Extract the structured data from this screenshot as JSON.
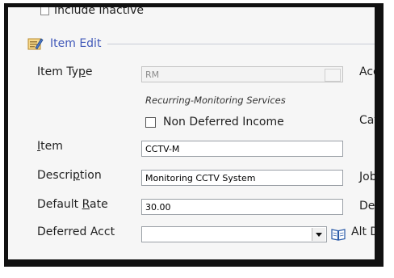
{
  "top_option": {
    "label": "Include Inactive"
  },
  "section": {
    "title": "Item Edit"
  },
  "item_type": {
    "label_pre": "Item Ty",
    "label_key": "p",
    "label_post": "e",
    "value": "RM",
    "description": "Recurring-Monitoring Services"
  },
  "non_deferred": {
    "label": "Non Deferred Income",
    "checked": false
  },
  "item": {
    "label_key": "I",
    "label_post": "tem",
    "value": "CCTV-M"
  },
  "description": {
    "label_pre": "Descri",
    "label_key": "p",
    "label_post": "tion",
    "value": "Monitoring CCTV System"
  },
  "default_rate": {
    "label_pre": "Default ",
    "label_key": "R",
    "label_post": "ate",
    "value": "30.00"
  },
  "deferred_acct": {
    "label": "Deferred Acct",
    "value": ""
  },
  "right_column": [
    "Acc",
    "Cat",
    "Job",
    "Def",
    "Alt D"
  ],
  "colors": {
    "accent": "#4159b9",
    "border": "#111111"
  }
}
